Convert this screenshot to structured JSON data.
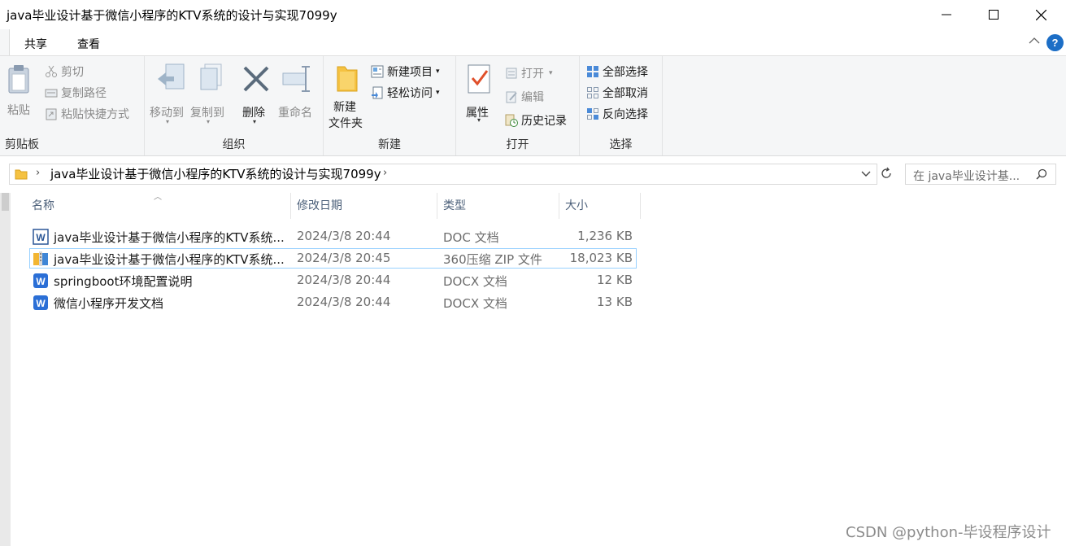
{
  "window": {
    "title": "java毕业设计基于微信小程序的KTV系统的设计与实现7099y"
  },
  "ribbon_tabs": {
    "share": "共享",
    "view": "查看"
  },
  "clipboard": {
    "paste": "粘贴",
    "cut": "剪切",
    "copy_path": "复制路径",
    "paste_shortcut": "粘贴快捷方式",
    "label": "剪贴板"
  },
  "organize": {
    "move_to": "移动到",
    "copy_to": "复制到",
    "delete": "删除",
    "rename": "重命名",
    "label": "组织"
  },
  "new": {
    "new_folder_line1": "新建",
    "new_folder_line2": "文件夹",
    "new_item": "新建项目",
    "easy_access": "轻松访问",
    "label": "新建"
  },
  "open": {
    "properties": "属性",
    "open": "打开",
    "edit": "编辑",
    "history": "历史记录",
    "label": "打开"
  },
  "select": {
    "select_all": "全部选择",
    "select_none": "全部取消",
    "invert": "反向选择",
    "label": "选择"
  },
  "address": {
    "path": "java毕业设计基于微信小程序的KTV系统的设计与实现7099y",
    "search_placeholder": "在 java毕业设计基..."
  },
  "columns": {
    "name": "名称",
    "date": "修改日期",
    "type": "类型",
    "size": "大小"
  },
  "files": [
    {
      "name": "java毕业设计基于微信小程序的KTV系统...",
      "date": "2024/3/8 20:44",
      "type": "DOC 文档",
      "size": "1,236 KB",
      "icon": "word-doc-icon"
    },
    {
      "name": "java毕业设计基于微信小程序的KTV系统...",
      "date": "2024/3/8 20:45",
      "type": "360压缩 ZIP 文件",
      "size": "18,023 KB",
      "icon": "zip-archive-icon"
    },
    {
      "name": "springboot环境配置说明",
      "date": "2024/3/8 20:44",
      "type": "DOCX 文档",
      "size": "12 KB",
      "icon": "wps-word-icon"
    },
    {
      "name": "微信小程序开发文档",
      "date": "2024/3/8 20:44",
      "type": "DOCX 文档",
      "size": "13 KB",
      "icon": "wps-word-icon"
    }
  ],
  "watermark": "CSDN @python-毕设程序设计",
  "colors": {
    "accent": "#1c6ec6",
    "selection_border": "#99d1ff",
    "ribbon_bg": "#f5f6f7",
    "header_text": "#4c607a"
  }
}
